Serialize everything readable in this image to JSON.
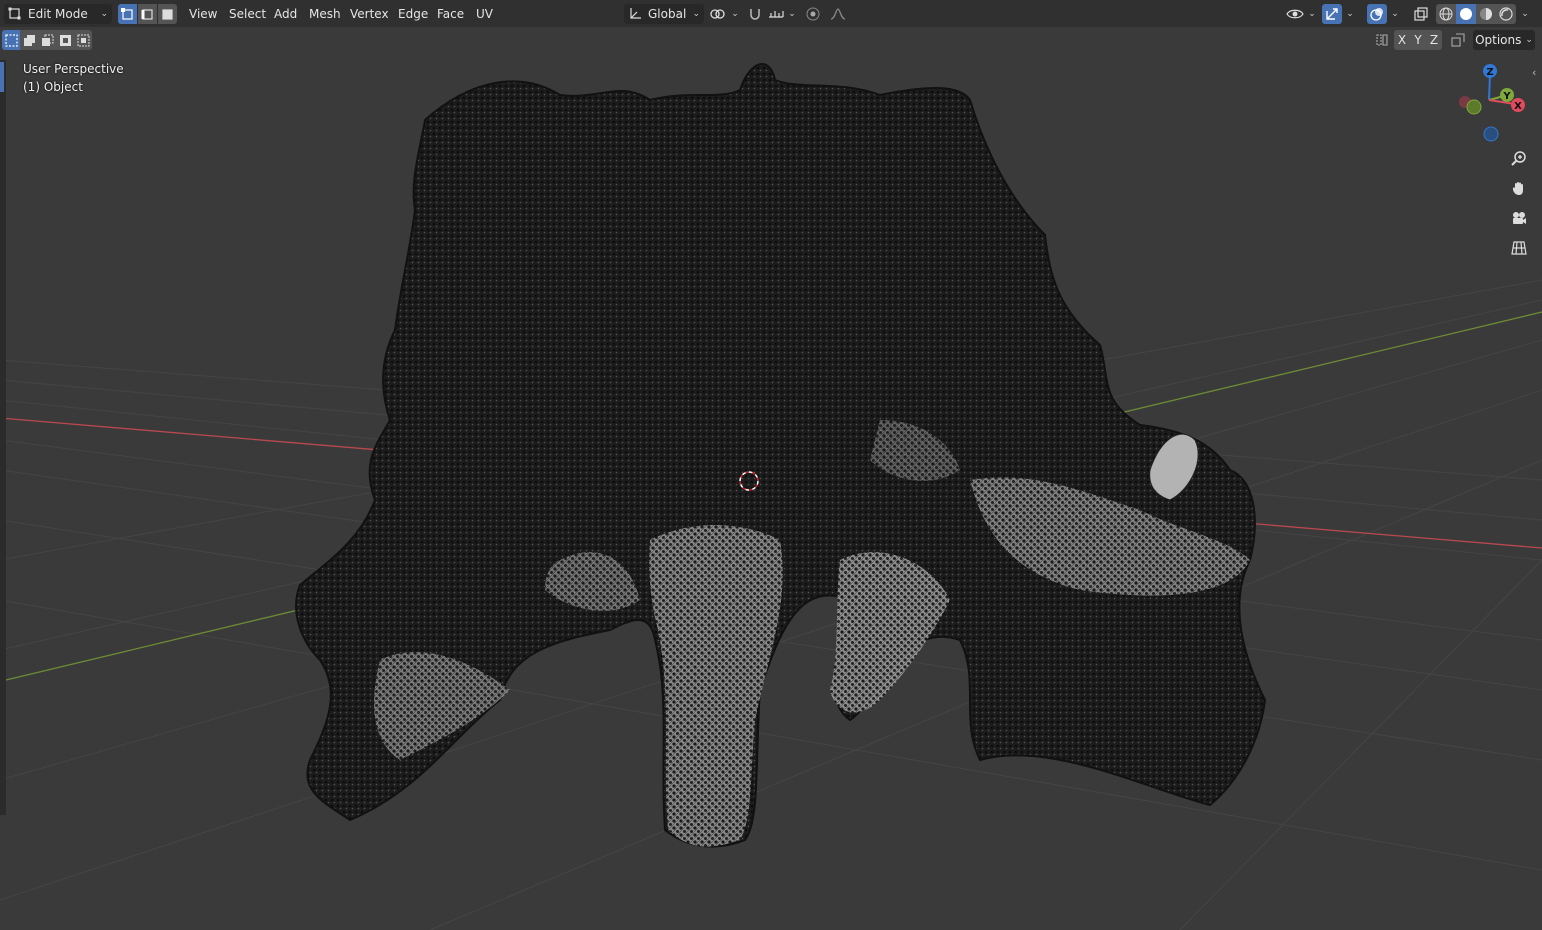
{
  "header": {
    "mode": {
      "label": "Edit Mode",
      "icon": "edit-mode-icon"
    },
    "select_modes": [
      "vertex-select-icon",
      "edge-select-icon",
      "face-select-icon"
    ],
    "menus": [
      "View",
      "Select",
      "Add",
      "Mesh",
      "Vertex",
      "Edge",
      "Face",
      "UV"
    ],
    "transform_orientation": {
      "label": "Global",
      "icon": "orientation-icon"
    },
    "pivot_icon": "pivot-icon",
    "snap_icons": [
      "snap-icon",
      "snap-increment-icon"
    ],
    "proportional_icons": [
      "proportional-editing-icon",
      "falloff-icon"
    ],
    "right_icons": [
      "visibility-icon",
      "gizmo-icon",
      "overlay-icon",
      "xray-icon"
    ],
    "shading_modes": [
      "wireframe-shading-icon",
      "solid-shading-icon",
      "material-shading-icon",
      "rendered-shading-icon"
    ]
  },
  "subheader": {
    "select_box_modes": [
      "select-new-icon",
      "select-extend-icon",
      "select-subtract-icon",
      "select-invert-icon",
      "select-intersect-icon"
    ],
    "mirror_axes": [
      "X",
      "Y",
      "Z"
    ],
    "options_label": "Options"
  },
  "viewport": {
    "view_name": "User Perspective",
    "object_name": "(1) Object"
  },
  "gizmo": {
    "axes": [
      "Z",
      "Y",
      "X"
    ],
    "colors": {
      "x": "#e04b5e",
      "y": "#7fa93a",
      "z": "#2f78d6"
    }
  },
  "nav_icons": [
    "zoom-icon",
    "pan-hand-icon",
    "camera-view-icon",
    "ortho-grid-icon"
  ],
  "colors": {
    "background": "#3a3a3a",
    "header": "#303030",
    "accent": "#4772b3",
    "grid_x_axis": "#b8494f",
    "grid_y_axis": "#6d8b35"
  }
}
